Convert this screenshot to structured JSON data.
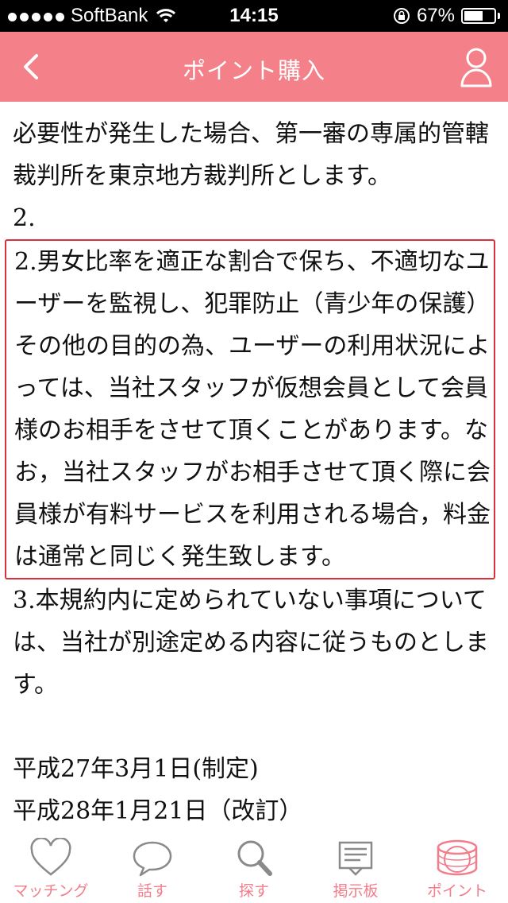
{
  "status_bar": {
    "carrier": "SoftBank",
    "time": "14:15",
    "battery": "67%",
    "battery_level": 0.67
  },
  "nav": {
    "title": "ポイント購入",
    "back_icon": "chevron-left-icon",
    "user_icon": "user-icon"
  },
  "content": {
    "paragraphs_before": [
      "必要性が発生した場合、第一審の専属的管轄裁判所を東京地方裁判所とします。",
      "2."
    ],
    "highlighted": [
      "2.男女比率を適正な割合で保ち、不適切なユーザーを監視し、犯罪防止（青少年の保護）",
      "その他の目的の為、ユーザーの利用状況によっては、当社スタッフが仮想会員として会員様のお相手をさせて頂くことがあります。なお，当社スタッフがお相手させて頂く際に会員様が有料サービスを利用される場合，料金は通常と同じく発生致します。"
    ],
    "paragraphs_after": [
      "3.本規約内に定められていない事項については、当社が別途定める内容に従うものとします。"
    ],
    "dates": [
      "平成27年3月1日(制定)",
      "平成28年1月21日（改訂）"
    ]
  },
  "tabs": [
    {
      "label": "マッチング",
      "icon": "heart-icon"
    },
    {
      "label": "話す",
      "icon": "chat-bubble-icon"
    },
    {
      "label": "探す",
      "icon": "search-icon"
    },
    {
      "label": "掲示板",
      "icon": "bulletin-board-icon"
    },
    {
      "label": "ポイント",
      "icon": "coin-icon"
    }
  ],
  "colors": {
    "accent": "#f4818a",
    "highlight_border": "#d9323a",
    "tab_label": "#f27d8b"
  }
}
